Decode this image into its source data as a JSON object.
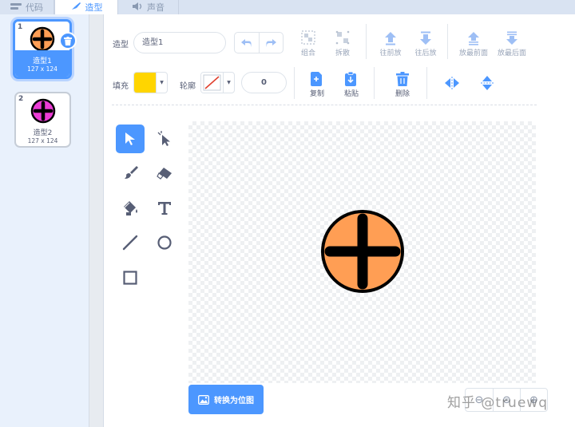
{
  "tabs": [
    {
      "label": "代码",
      "icon": "code-icon"
    },
    {
      "label": "造型",
      "icon": "brush-icon",
      "active": true
    },
    {
      "label": "声音",
      "icon": "speaker-icon"
    }
  ],
  "costumes": [
    {
      "number": "1",
      "name": "造型1",
      "size": "127 x 124",
      "color": "#ff9e54",
      "selected": true
    },
    {
      "number": "2",
      "name": "造型2",
      "size": "127 x 124",
      "color": "#ec3cd6",
      "selected": false
    }
  ],
  "toolbar": {
    "costume_label": "造型",
    "costume_name": "造型1",
    "group": "组合",
    "ungroup": "拆散",
    "forward": "往前放",
    "backward": "往后放",
    "front": "放最前面",
    "back": "放最后面",
    "fill_label": "填充",
    "fill_color": "#ffd500",
    "outline_label": "轮廓",
    "stroke_width": "0",
    "copy": "复制",
    "paste": "粘贴",
    "delete": "删除"
  },
  "canvas": {
    "sprite_fill": "#ff9e54",
    "sprite_stroke": "#000000"
  },
  "convert_button": "转换为位图",
  "watermark": "知乎 @truewq",
  "colors": {
    "accent": "#4c97ff",
    "text": "#575e75",
    "disabled": "#9aa6ba"
  }
}
